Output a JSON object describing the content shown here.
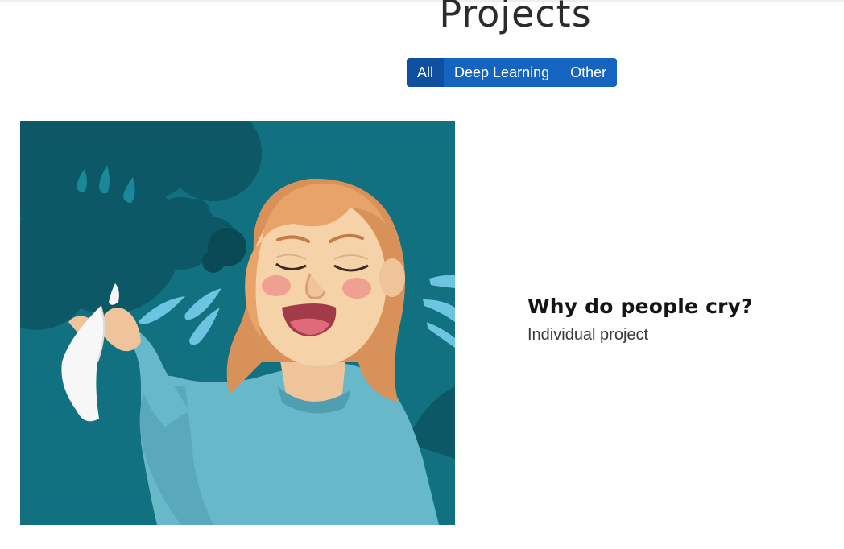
{
  "header": {
    "title": "Projects"
  },
  "filters": {
    "items": [
      {
        "label": "All",
        "active": true
      },
      {
        "label": "Deep Learning",
        "active": false
      },
      {
        "label": "Other",
        "active": false
      }
    ],
    "color": "#1565c0",
    "active_color": "#0f4fa0"
  },
  "project": {
    "title": "Why do people cry?",
    "subtitle": "Individual project",
    "image_icon": "crying-woman-illustration"
  }
}
